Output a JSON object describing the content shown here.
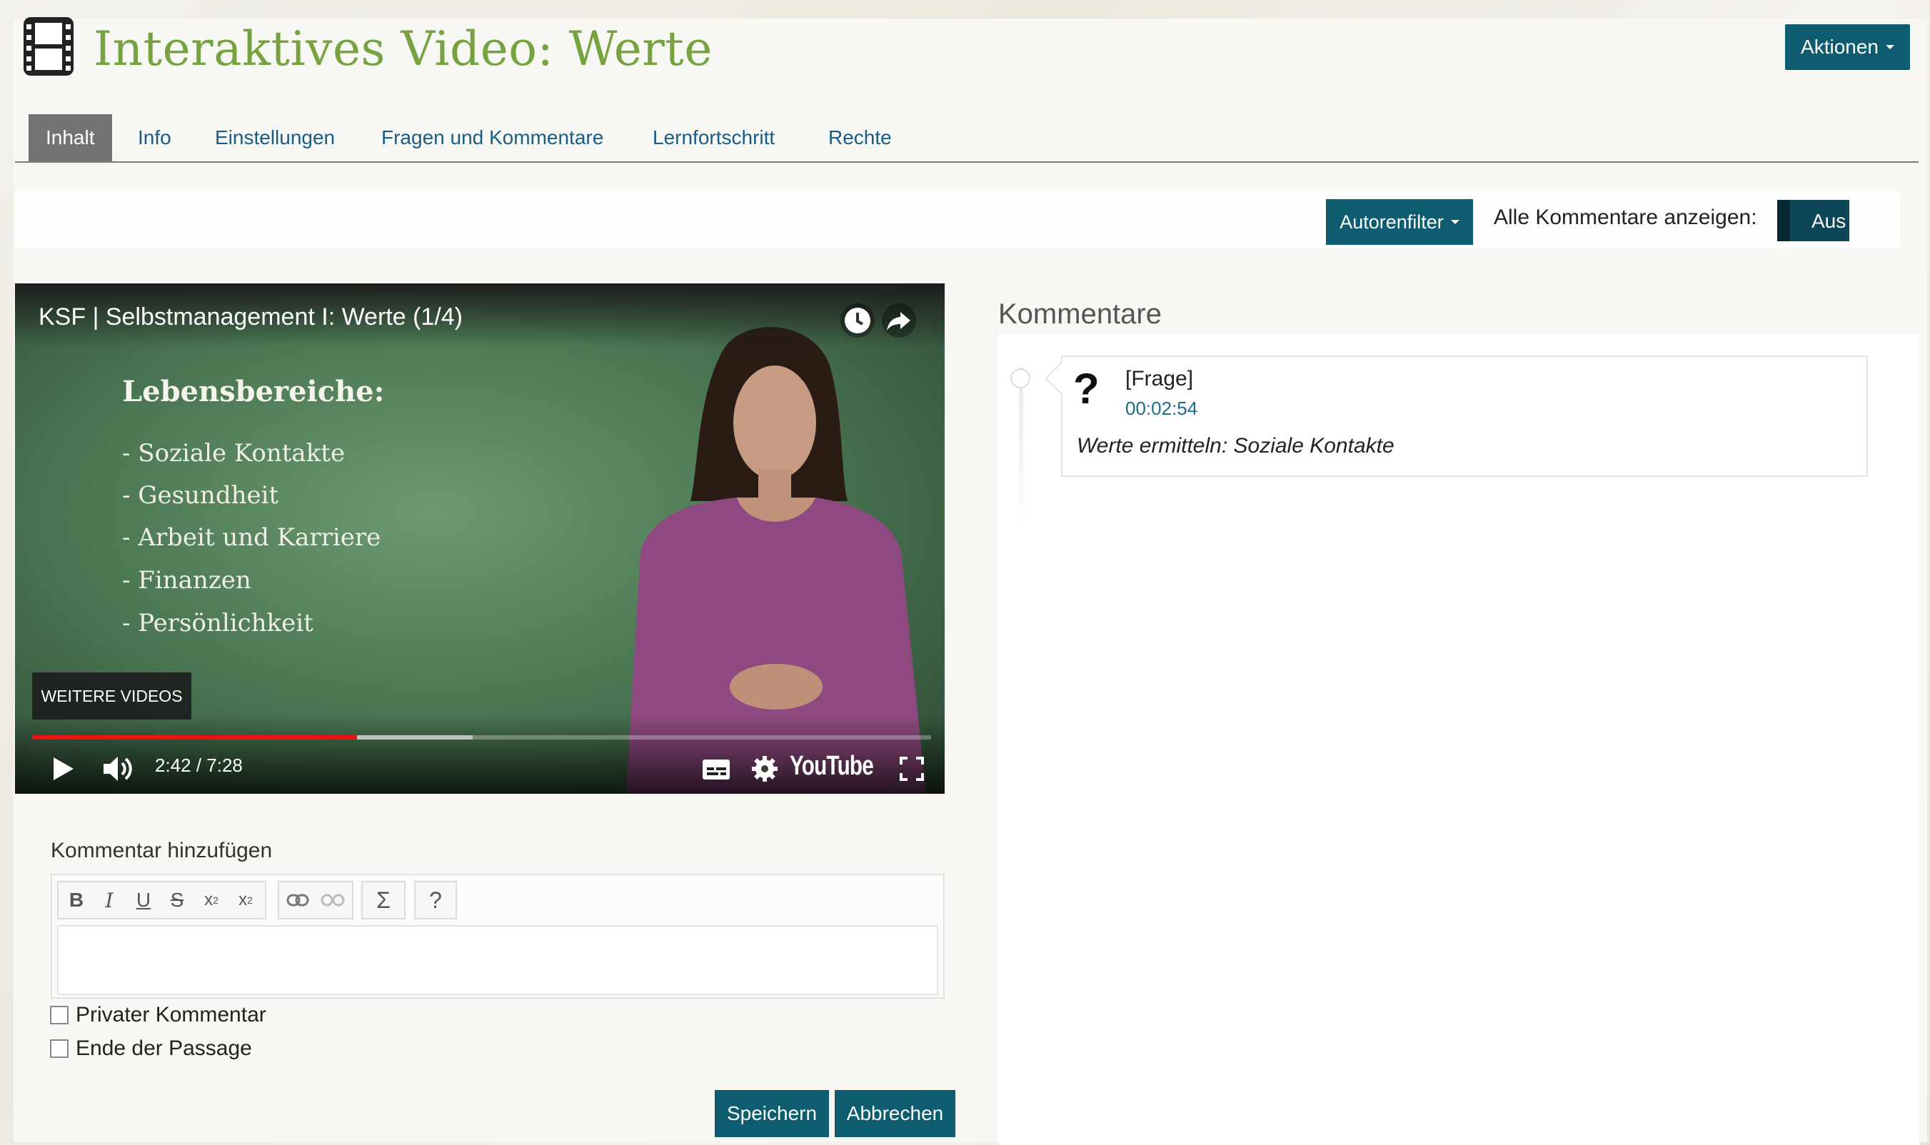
{
  "header": {
    "title": "Interaktives Video: Werte",
    "actions_label": "Aktionen"
  },
  "tabs": [
    {
      "label": "Inhalt",
      "active": true
    },
    {
      "label": "Info"
    },
    {
      "label": "Einstellungen"
    },
    {
      "label": "Fragen und Kommentare"
    },
    {
      "label": "Lernfortschritt"
    },
    {
      "label": "Rechte"
    }
  ],
  "toolbar": {
    "author_filter_label": "Autorenfilter",
    "show_all_label": "Alle Kommentare anzeigen:",
    "toggle_state": "Aus"
  },
  "video": {
    "title": "KSF | Selbstmanagement I: Werte (1/4)",
    "slide": {
      "heading": "Lebensbereiche:",
      "items": [
        "- Soziale Kontakte",
        "- Gesundheit",
        "- Arbeit und Karriere",
        "- Finanzen",
        "- Persönlichkeit"
      ]
    },
    "more_videos_label": "WEITERE VIDEOS",
    "time": "2:42 / 7:28",
    "played_fraction": 0.3616,
    "buffered_fraction": 0.49,
    "brand": "YouTube"
  },
  "comments": {
    "heading": "Kommentare",
    "items": [
      {
        "type": "[Frage]",
        "time": "00:02:54",
        "text": "Werte ermitteln: Soziale Kontakte"
      }
    ]
  },
  "add_comment": {
    "label": "Kommentar hinzufügen",
    "text_value": "",
    "private_label": "Privater Kommentar",
    "private_checked": false,
    "end_label": "Ende der Passage",
    "end_checked": false,
    "save_label": "Speichern",
    "cancel_label": "Abbrechen"
  },
  "colors": {
    "accent": "#0d5c6f",
    "title_green": "#76a33f",
    "link_blue": "#185d88",
    "progress_red": "#e11111"
  }
}
